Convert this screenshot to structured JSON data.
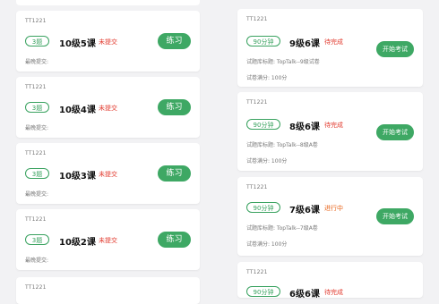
{
  "colors": {
    "accent": "#3ea864",
    "pill_border": "#39a25f",
    "status_red": "#e23a2e",
    "status_orange": "#e8641a"
  },
  "left_cards": [
    {
      "tag": "TT1221",
      "count": "3题",
      "title": "10级5课",
      "status": "未提交",
      "last_submit": "最晚提交:",
      "button": "练习"
    },
    {
      "tag": "TT1221",
      "count": "3题",
      "title": "10级4课",
      "status": "未提交",
      "last_submit": "最晚提交:",
      "button": "练习"
    },
    {
      "tag": "TT1221",
      "count": "3题",
      "title": "10级3课",
      "status": "未提交",
      "last_submit": "最晚提交:",
      "button": "练习"
    },
    {
      "tag": "TT1221",
      "count": "3题",
      "title": "10级2课",
      "status": "未提交",
      "last_submit": "最晚提交:",
      "button": "练习"
    },
    {
      "tag": "TT1221"
    }
  ],
  "right_cards": [
    {
      "tag": "TT1221",
      "duration": "90分钟",
      "title": "9级6课",
      "status": "待完成",
      "paper": "试题库标题: TopTalk--9级试卷",
      "full_score": "试卷满分: 100分",
      "button": "开始考试"
    },
    {
      "tag": "TT1221",
      "duration": "90分钟",
      "title": "8级6课",
      "status": "待完成",
      "paper": "试题库标题: TopTalk--8级A卷",
      "full_score": "试卷满分: 100分",
      "button": "开始考试"
    },
    {
      "tag": "TT1221",
      "duration": "90分钟",
      "title": "7级6课",
      "status": "进行中",
      "paper": "试题库标题: TopTalk--7级A卷",
      "full_score": "试卷满分: 100分",
      "button": "开始考试"
    },
    {
      "tag": "TT1221",
      "duration": "90分钟",
      "title": "6级6课",
      "status": "待完成"
    }
  ]
}
